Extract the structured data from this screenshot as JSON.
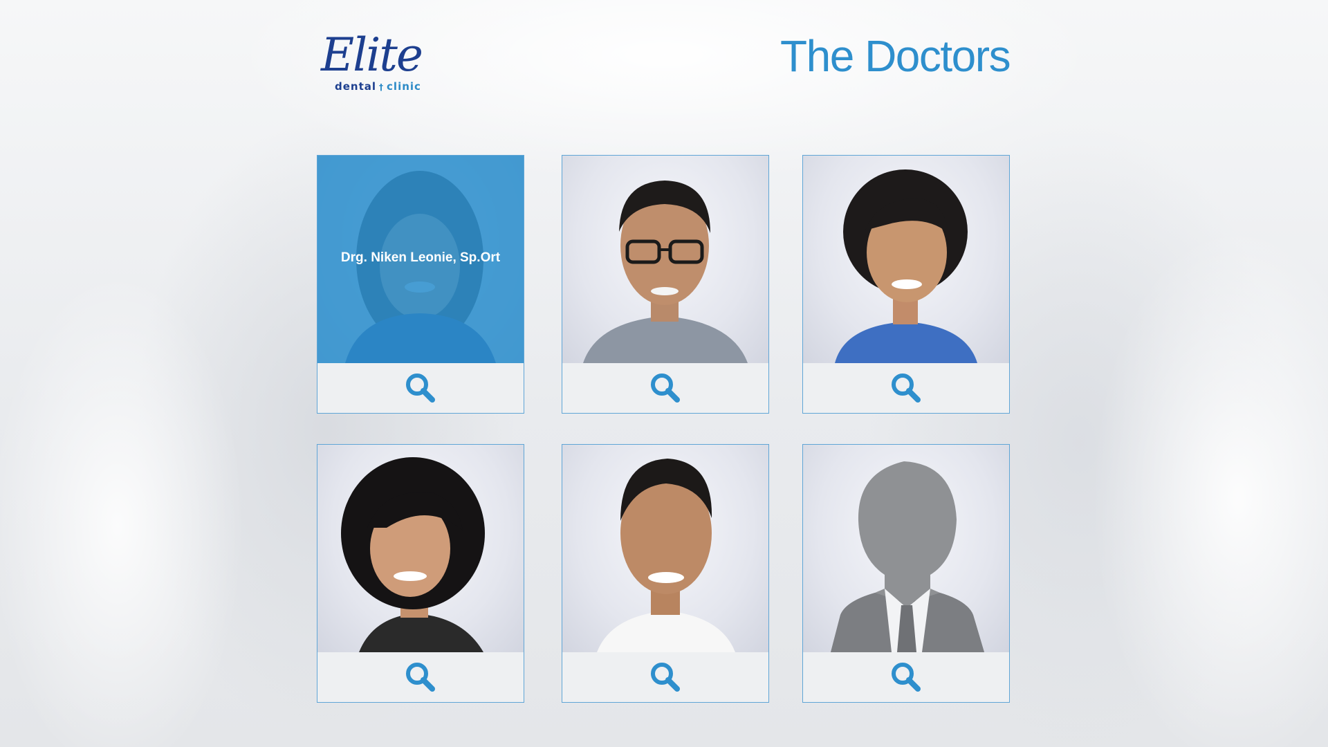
{
  "header": {
    "logo_script": "Elite",
    "logo_sub_left": "dental",
    "logo_sub_right": "clinic",
    "title": "The Doctors"
  },
  "colors": {
    "accent": "#2e8fcd",
    "brand_navy": "#1d3f8f",
    "card_border": "#5fa5d6"
  },
  "doctors": [
    {
      "name": "Drg. Niken Leonie, Sp.Ort",
      "hovered": true,
      "portrait": "woman-curly-hair"
    },
    {
      "portrait": "man-glasses"
    },
    {
      "portrait": "woman-short-hair"
    },
    {
      "portrait": "woman-bob-hair"
    },
    {
      "portrait": "man-smiling"
    },
    {
      "portrait": "silhouette-placeholder"
    }
  ],
  "icons": {
    "zoom": "magnifier-icon"
  }
}
